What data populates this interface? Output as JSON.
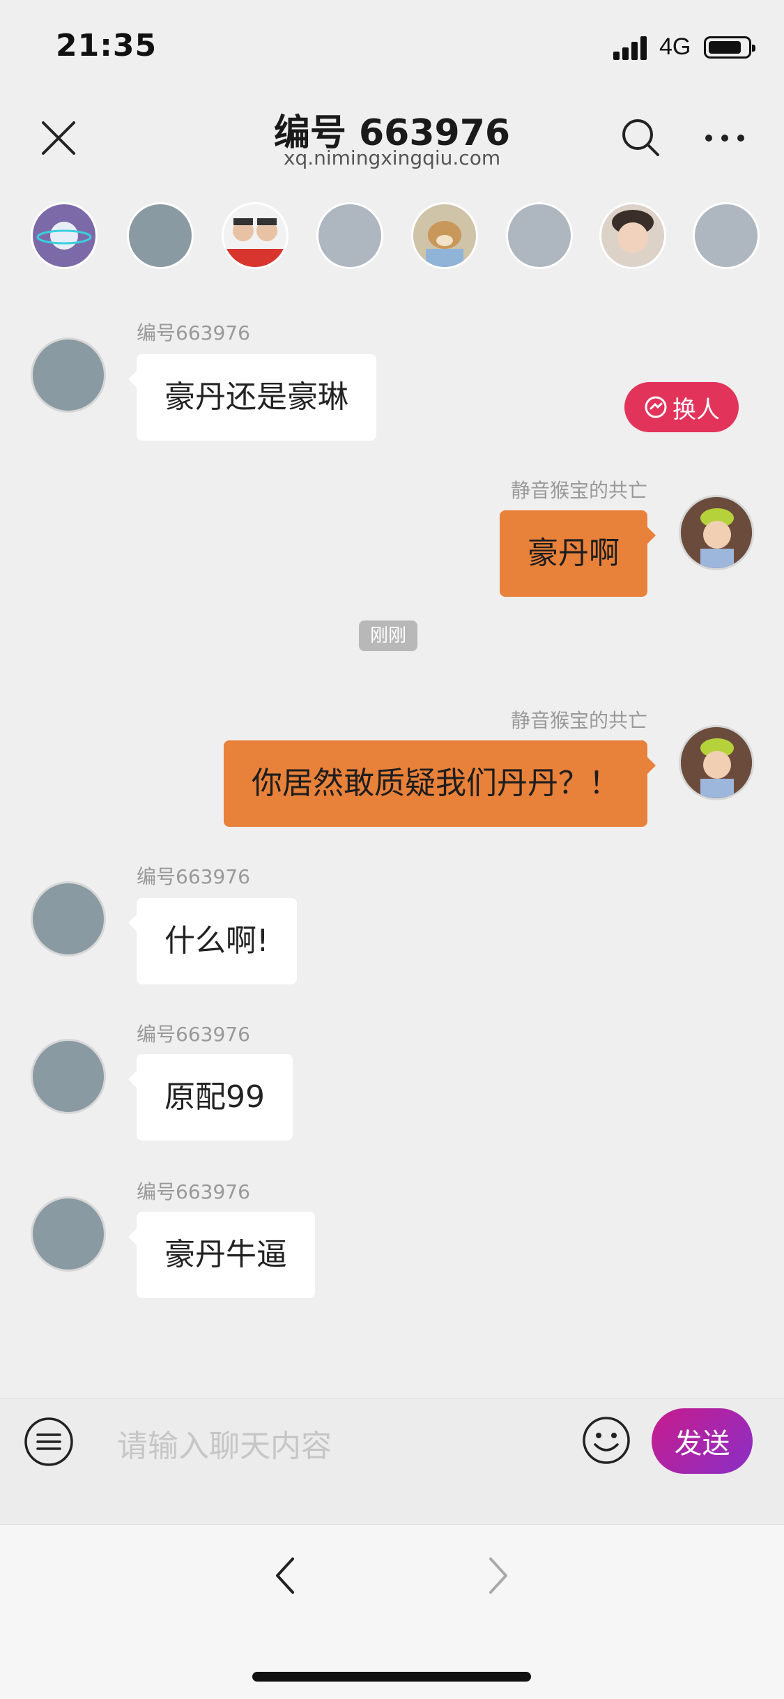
{
  "status_bar": {
    "time": "21:35",
    "network": "4G"
  },
  "header": {
    "title": "编号 663976",
    "url": "xq.nimingxingqiu.com"
  },
  "swap_button": {
    "label": "换人"
  },
  "messages": [
    {
      "side": "in",
      "sender": "编号663976",
      "text": "豪丹还是豪琳"
    },
    {
      "side": "out",
      "sender": "静音猴宝的共亡",
      "text": "豪丹啊"
    },
    {
      "side": "out",
      "sender": "静音猴宝的共亡",
      "text": "你居然敢质疑我们丹丹？！"
    },
    {
      "side": "in",
      "sender": "编号663976",
      "text": "什么啊!"
    },
    {
      "side": "in",
      "sender": "编号663976",
      "text": "原配99"
    },
    {
      "side": "in",
      "sender": "编号663976",
      "text": "豪丹牛逼"
    }
  ],
  "timestamp": "刚刚",
  "input": {
    "placeholder": "请输入聊天内容",
    "send_label": "发送"
  },
  "colors": {
    "out_bubble": "#e8813a",
    "swap_button": "#e2335a",
    "send_gradient": [
      "#c81c8c",
      "#8a2fc7"
    ]
  }
}
